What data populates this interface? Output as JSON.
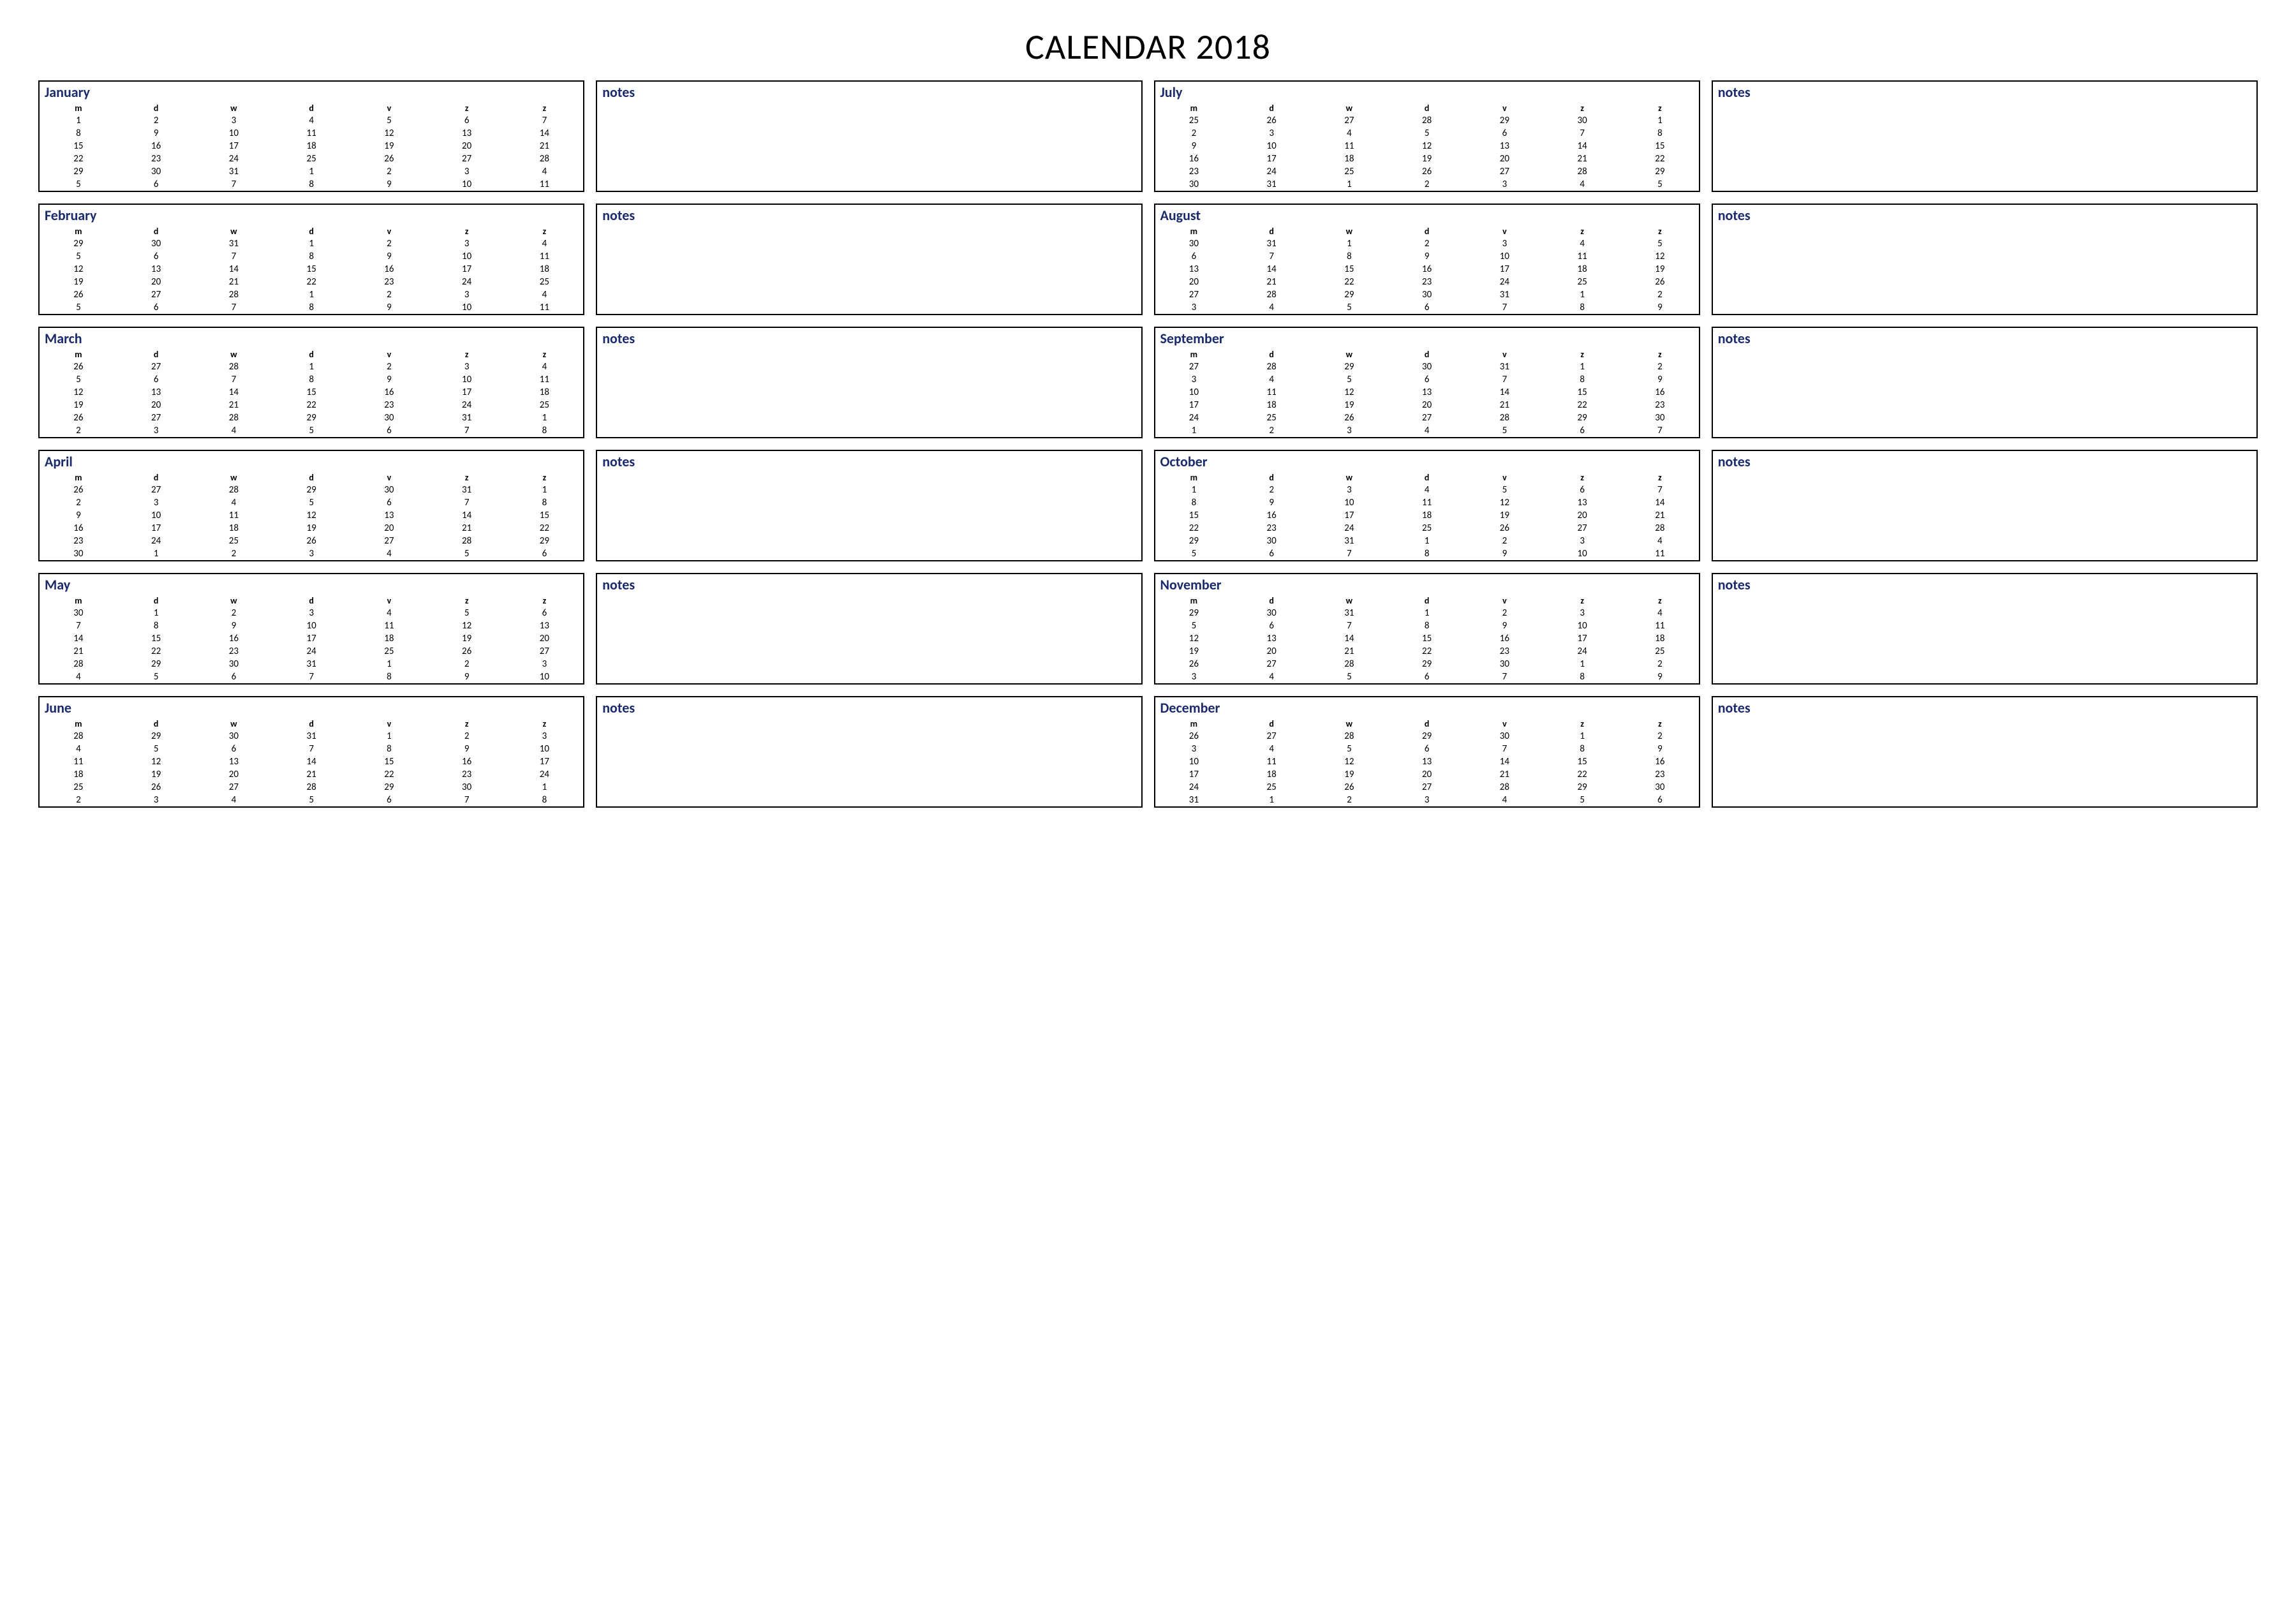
{
  "title": "CALENDAR 2018",
  "dayHeaders": [
    "m",
    "d",
    "w",
    "d",
    "v",
    "z",
    "z"
  ],
  "notesLabel": "notes",
  "columns": [
    [
      {
        "name": "January",
        "weeks": [
          [
            1,
            2,
            3,
            4,
            5,
            6,
            7
          ],
          [
            8,
            9,
            10,
            11,
            12,
            13,
            14
          ],
          [
            15,
            16,
            17,
            18,
            19,
            20,
            21
          ],
          [
            22,
            23,
            24,
            25,
            26,
            27,
            28
          ],
          [
            29,
            30,
            31,
            1,
            2,
            3,
            4
          ],
          [
            5,
            6,
            7,
            8,
            9,
            10,
            11
          ]
        ]
      },
      {
        "name": "February",
        "weeks": [
          [
            29,
            30,
            31,
            1,
            2,
            3,
            4
          ],
          [
            5,
            6,
            7,
            8,
            9,
            10,
            11
          ],
          [
            12,
            13,
            14,
            15,
            16,
            17,
            18
          ],
          [
            19,
            20,
            21,
            22,
            23,
            24,
            25
          ],
          [
            26,
            27,
            28,
            1,
            2,
            3,
            4
          ],
          [
            5,
            6,
            7,
            8,
            9,
            10,
            11
          ]
        ]
      },
      {
        "name": "March",
        "weeks": [
          [
            26,
            27,
            28,
            1,
            2,
            3,
            4
          ],
          [
            5,
            6,
            7,
            8,
            9,
            10,
            11
          ],
          [
            12,
            13,
            14,
            15,
            16,
            17,
            18
          ],
          [
            19,
            20,
            21,
            22,
            23,
            24,
            25
          ],
          [
            26,
            27,
            28,
            29,
            30,
            31,
            1
          ],
          [
            2,
            3,
            4,
            5,
            6,
            7,
            8
          ]
        ]
      },
      {
        "name": "April",
        "weeks": [
          [
            26,
            27,
            28,
            29,
            30,
            31,
            1
          ],
          [
            2,
            3,
            4,
            5,
            6,
            7,
            8
          ],
          [
            9,
            10,
            11,
            12,
            13,
            14,
            15
          ],
          [
            16,
            17,
            18,
            19,
            20,
            21,
            22
          ],
          [
            23,
            24,
            25,
            26,
            27,
            28,
            29
          ],
          [
            30,
            1,
            2,
            3,
            4,
            5,
            6
          ]
        ]
      },
      {
        "name": "May",
        "weeks": [
          [
            30,
            1,
            2,
            3,
            4,
            5,
            6
          ],
          [
            7,
            8,
            9,
            10,
            11,
            12,
            13
          ],
          [
            14,
            15,
            16,
            17,
            18,
            19,
            20
          ],
          [
            21,
            22,
            23,
            24,
            25,
            26,
            27
          ],
          [
            28,
            29,
            30,
            31,
            1,
            2,
            3
          ],
          [
            4,
            5,
            6,
            7,
            8,
            9,
            10
          ]
        ]
      },
      {
        "name": "June",
        "weeks": [
          [
            28,
            29,
            30,
            31,
            1,
            2,
            3
          ],
          [
            4,
            5,
            6,
            7,
            8,
            9,
            10
          ],
          [
            11,
            12,
            13,
            14,
            15,
            16,
            17
          ],
          [
            18,
            19,
            20,
            21,
            22,
            23,
            24
          ],
          [
            25,
            26,
            27,
            28,
            29,
            30,
            1
          ],
          [
            2,
            3,
            4,
            5,
            6,
            7,
            8
          ]
        ]
      }
    ],
    [
      {
        "name": "July",
        "weeks": [
          [
            25,
            26,
            27,
            28,
            29,
            30,
            1
          ],
          [
            2,
            3,
            4,
            5,
            6,
            7,
            8
          ],
          [
            9,
            10,
            11,
            12,
            13,
            14,
            15
          ],
          [
            16,
            17,
            18,
            19,
            20,
            21,
            22
          ],
          [
            23,
            24,
            25,
            26,
            27,
            28,
            29
          ],
          [
            30,
            31,
            1,
            2,
            3,
            4,
            5
          ]
        ]
      },
      {
        "name": "August",
        "weeks": [
          [
            30,
            31,
            1,
            2,
            3,
            4,
            5
          ],
          [
            6,
            7,
            8,
            9,
            10,
            11,
            12
          ],
          [
            13,
            14,
            15,
            16,
            17,
            18,
            19
          ],
          [
            20,
            21,
            22,
            23,
            24,
            25,
            26
          ],
          [
            27,
            28,
            29,
            30,
            31,
            1,
            2
          ],
          [
            3,
            4,
            5,
            6,
            7,
            8,
            9
          ]
        ]
      },
      {
        "name": "September",
        "weeks": [
          [
            27,
            28,
            29,
            30,
            31,
            1,
            2
          ],
          [
            3,
            4,
            5,
            6,
            7,
            8,
            9
          ],
          [
            10,
            11,
            12,
            13,
            14,
            15,
            16
          ],
          [
            17,
            18,
            19,
            20,
            21,
            22,
            23
          ],
          [
            24,
            25,
            26,
            27,
            28,
            29,
            30
          ],
          [
            1,
            2,
            3,
            4,
            5,
            6,
            7
          ]
        ]
      },
      {
        "name": "October",
        "weeks": [
          [
            1,
            2,
            3,
            4,
            5,
            6,
            7
          ],
          [
            8,
            9,
            10,
            11,
            12,
            13,
            14
          ],
          [
            15,
            16,
            17,
            18,
            19,
            20,
            21
          ],
          [
            22,
            23,
            24,
            25,
            26,
            27,
            28
          ],
          [
            29,
            30,
            31,
            1,
            2,
            3,
            4
          ],
          [
            5,
            6,
            7,
            8,
            9,
            10,
            11
          ]
        ]
      },
      {
        "name": "November",
        "weeks": [
          [
            29,
            30,
            31,
            1,
            2,
            3,
            4
          ],
          [
            5,
            6,
            7,
            8,
            9,
            10,
            11
          ],
          [
            12,
            13,
            14,
            15,
            16,
            17,
            18
          ],
          [
            19,
            20,
            21,
            22,
            23,
            24,
            25
          ],
          [
            26,
            27,
            28,
            29,
            30,
            1,
            2
          ],
          [
            3,
            4,
            5,
            6,
            7,
            8,
            9
          ]
        ]
      },
      {
        "name": "December",
        "weeks": [
          [
            26,
            27,
            28,
            29,
            30,
            1,
            2
          ],
          [
            3,
            4,
            5,
            6,
            7,
            8,
            9
          ],
          [
            10,
            11,
            12,
            13,
            14,
            15,
            16
          ],
          [
            17,
            18,
            19,
            20,
            21,
            22,
            23
          ],
          [
            24,
            25,
            26,
            27,
            28,
            29,
            30
          ],
          [
            31,
            1,
            2,
            3,
            4,
            5,
            6
          ]
        ]
      }
    ]
  ]
}
